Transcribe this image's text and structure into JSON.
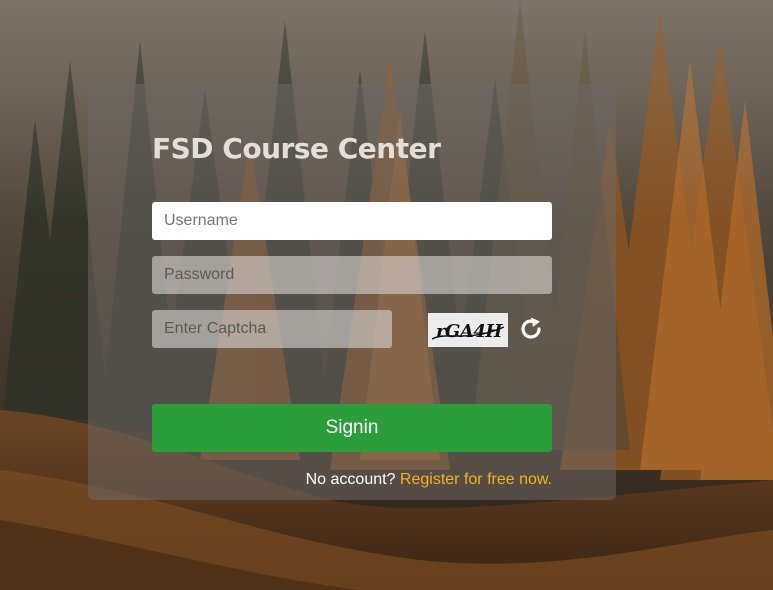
{
  "app": {
    "title": "FSD Course Center"
  },
  "login_form": {
    "username": {
      "value": "",
      "placeholder": "Username"
    },
    "password": {
      "value": "",
      "placeholder": "Password"
    },
    "captcha": {
      "value": "",
      "placeholder": "Enter Captcha",
      "image_text": "rGA4H",
      "refresh_icon": "refresh-icon"
    },
    "signin_label": "Signin",
    "register_prompt": "No account?",
    "register_link": "Register for free now."
  },
  "colors": {
    "signin_button": "#2b9d3a",
    "register_link": "#f2b21b",
    "title": "#e4ded8"
  }
}
